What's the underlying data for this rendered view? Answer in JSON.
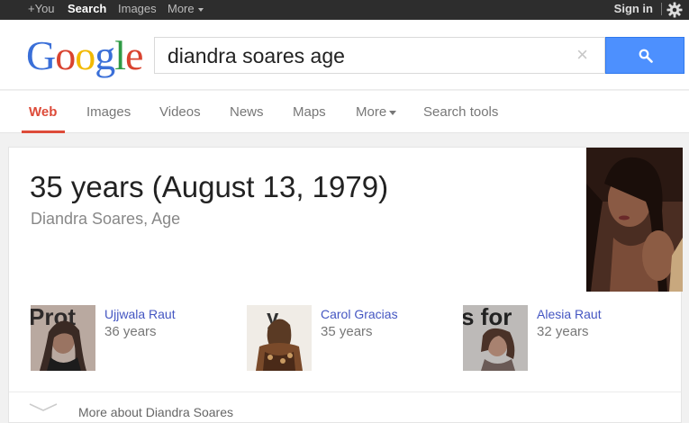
{
  "topbar": {
    "items": [
      "+You",
      "Search",
      "Images",
      "More"
    ],
    "signin": "Sign in"
  },
  "logo": {
    "letters": [
      "G",
      "o",
      "o",
      "g",
      "l",
      "e"
    ]
  },
  "search": {
    "query": "diandra soares age",
    "clear": "×"
  },
  "tabs": [
    "Web",
    "Images",
    "Videos",
    "News",
    "Maps",
    "More",
    "Search tools"
  ],
  "answer": {
    "value": "35 years (August 13, 1979)",
    "subtitle": "Diandra Soares, Age"
  },
  "related": [
    {
      "name": "Ujjwala Raut",
      "age": "36 years"
    },
    {
      "name": "Carol Gracias",
      "age": "35 years"
    },
    {
      "name": "Alesia Raut",
      "age": "32 years"
    }
  ],
  "more_link": "More about Diandra Soares",
  "colors": {
    "accent_red": "#dd4b39",
    "search_blue": "#4d90fe",
    "link": "#4456c2"
  }
}
